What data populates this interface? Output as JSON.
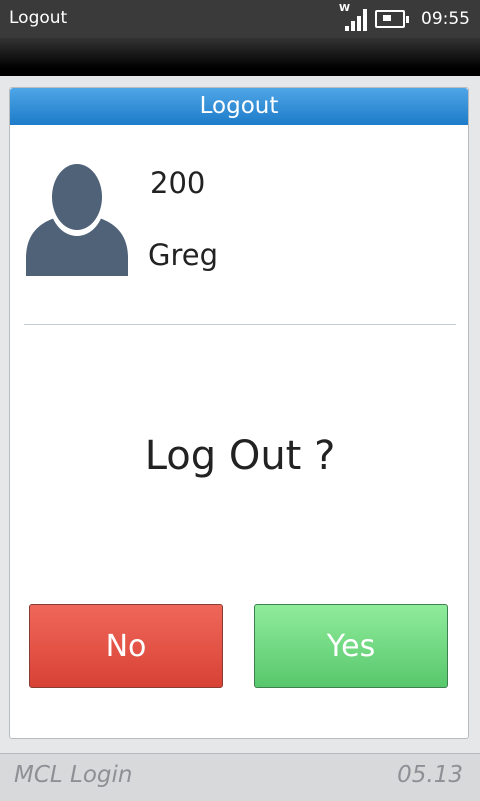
{
  "status_bar": {
    "title": "Logout",
    "network_label": "W",
    "time": "09:55",
    "icons": [
      "signal-icon",
      "battery-icon"
    ]
  },
  "dialog": {
    "title": "Logout",
    "user": {
      "id": "200",
      "name": "Greg",
      "avatar_icon": "user-avatar-icon"
    },
    "question": "Log Out ?",
    "no_label": "No",
    "yes_label": "Yes"
  },
  "footer": {
    "app_name": "MCL Login",
    "version": "05.13"
  },
  "colors": {
    "header_blue": "#2a86d3",
    "no_red": "#e0544a",
    "yes_green": "#74db85",
    "avatar_slate": "#4f6278"
  }
}
